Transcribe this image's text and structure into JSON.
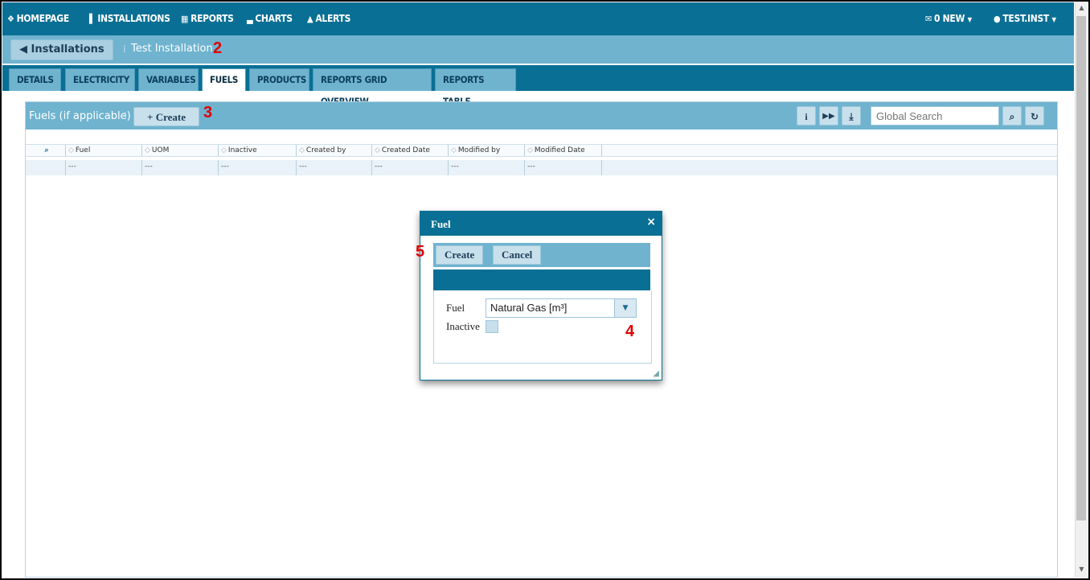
{
  "nav": {
    "items": [
      {
        "icon": "home-icon",
        "glyph": "❖",
        "label": "HOMEPAGE"
      },
      {
        "icon": "factory-icon",
        "glyph": "▌",
        "label": "INSTALLATIONS"
      },
      {
        "icon": "calendar-icon",
        "glyph": "▦",
        "label": "REPORTS"
      },
      {
        "icon": "bar-chart-icon",
        "glyph": "▃",
        "label": "CHARTS"
      },
      {
        "icon": "warning-icon",
        "glyph": "▲",
        "label": "ALERTS"
      }
    ],
    "messages": "0 NEW",
    "user": "TEST.INST"
  },
  "breadcrumb": {
    "back_label": "Installations",
    "current": "Test Installation"
  },
  "annotations": {
    "a2": "2",
    "a3": "3",
    "a4": "4",
    "a5": "5"
  },
  "tabs": [
    "DETAILS",
    "ELECTRICITY",
    "VARIABLES",
    "FUELS",
    "PRODUCTS",
    "REPORTS GRID OVERVIEW",
    "REPORTS TABLE"
  ],
  "active_tab": "FUELS",
  "toolbar": {
    "title": "Fuels (if applicable)",
    "create_label": "Create",
    "search_placeholder": "Global Search"
  },
  "grid": {
    "columns": [
      "Fuel",
      "UOM",
      "Inactive",
      "Created by",
      "Created Date",
      "Modified by",
      "Modified Date"
    ],
    "row": [
      "---",
      "---",
      "---",
      "---",
      "---",
      "---",
      "---"
    ]
  },
  "modal": {
    "title": "Fuel",
    "create_label": "Create",
    "cancel_label": "Cancel",
    "fuel_label": "Fuel",
    "fuel_value": "Natural Gas [m³]",
    "inactive_label": "Inactive",
    "inactive_checked": false
  },
  "colors": {
    "primary": "#0a6f94",
    "secondary": "#6fb3cf",
    "annotation": "#e10000"
  }
}
